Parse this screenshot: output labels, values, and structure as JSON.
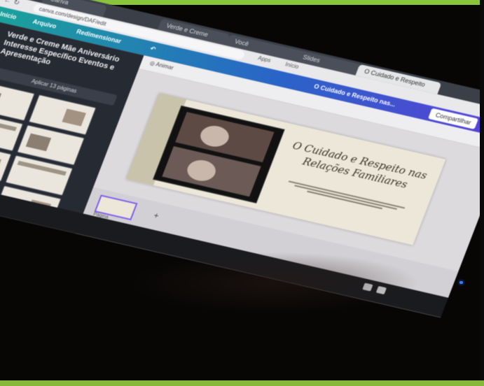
{
  "browser": {
    "tabs": [
      {
        "label": "Canva",
        "active": false
      },
      {
        "label": "Verde e Creme",
        "active": false
      },
      {
        "label": "Você",
        "active": false
      },
      {
        "label": "Slides",
        "active": false
      },
      {
        "label": "O Cuidado e Respeito",
        "active": true
      }
    ],
    "address": "canva.com/design/DAF/edit",
    "bookmarks": [
      "Apps",
      "Início"
    ]
  },
  "header": {
    "home_label": "Início",
    "file_label": "Arquivo",
    "resize_label": "Redimensionar",
    "doc_title": "O Cuidado e Respeito nas...",
    "share_label": "Compartilhar"
  },
  "left_panel": {
    "title": "Verde e Creme Mãe Aniversário Interesse Específico Eventos e Apresentação",
    "apply_label": "Aplicar 13 páginas"
  },
  "page_area": {
    "animate_label": "Animar",
    "slide_title": "O Cuidado e Respeito nas Relações Familiares",
    "page_label": "Página"
  },
  "colors": {
    "frame_top": "#8ac43a",
    "canva_gradient": [
      "#1aa39a",
      "#2a64c8",
      "#5b3fd6"
    ],
    "led": "#3a78ff"
  }
}
